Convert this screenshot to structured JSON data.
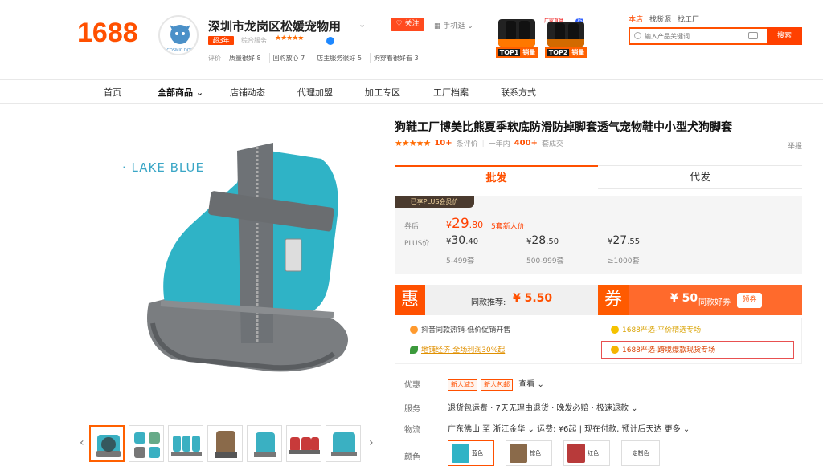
{
  "header": {
    "logo": "1688",
    "shop_name": "深圳市龙岗区松媛宠物用",
    "shop_badge": "超3年",
    "overall_label": "综合服务",
    "overall_stars": "★★★★★",
    "avatar_text": "COSMIC DOG",
    "eval_label": "评价",
    "eval_chips": [
      "质量很好 8",
      "回购放心 7",
      "店主服务很好 5",
      "狗穿着很好看 3"
    ],
    "follow_label": "关注",
    "mobile_label": "手机逛",
    "ad1_tag_num": "TOP1",
    "ad1_tag_text": "销量",
    "ad2_tag_num": "TOP2",
    "ad2_tag_text": "销量",
    "ad2_top": "厂家直供",
    "ad2_badge": "75",
    "search_tabs": [
      "本店",
      "找货源",
      "找工厂"
    ],
    "search_placeholder": "输入产品关键词",
    "search_button": "搜索"
  },
  "nav": {
    "items": [
      "首页",
      "全部商品",
      "店铺动态",
      "代理加盟",
      "加工专区",
      "工厂档案",
      "联系方式"
    ]
  },
  "product": {
    "image_caption": "· LAKE BLUE",
    "title": "狗鞋工厂博美比熊夏季软底防滑防掉脚套透气宠物鞋中小型犬狗脚套",
    "stars": "★★★★★",
    "review_count": "10+",
    "review_label": "条评价",
    "year_label": "一年内",
    "sales_count": "400+",
    "sales_label": "套成交",
    "report": "举报"
  },
  "tabs": {
    "wholesale": "批发",
    "dropship": "代发"
  },
  "price": {
    "plus_badge": "已享PLUS会员价",
    "coupon_label": "券后",
    "coupon_currency": "¥",
    "coupon_int": "29",
    "coupon_dec": ".80",
    "new_user": "5套新人价",
    "plus_label": "PLUS价",
    "tiers": [
      {
        "int": "30",
        "dec": ".40",
        "range": "5-499套"
      },
      {
        "int": "28",
        "dec": ".50",
        "range": "500-999套"
      },
      {
        "int": "27",
        "dec": ".55",
        "range": "≥1000套"
      }
    ]
  },
  "coupons": {
    "hui": "惠",
    "similar_label": "同款推荐:",
    "similar_price": "¥ 5.50",
    "quan": "券",
    "good_coupon_value": "¥ 50",
    "good_coupon_label": "同款好券",
    "claim": "领券"
  },
  "promos": [
    "抖音同款热销-低价促销开售",
    "1688严选-平价精选专场",
    "地铺经济-全场利润30%起",
    "1688严选-跨境爆款现货专场"
  ],
  "offers": {
    "label": "优惠",
    "tags": [
      "新人减3",
      "新人包邮"
    ],
    "more": "查看"
  },
  "service": {
    "label": "服务",
    "text": "退货包运费 · 7天无理由退货 · 晚发必赔 · 极速退款"
  },
  "logistics": {
    "label": "物流",
    "text": "广东佛山 至 浙江金华",
    "fee": "运费: ¥6起",
    "pay": "现在付款, 预计后天达",
    "more": "更多"
  },
  "colors": {
    "label": "颜色",
    "options": [
      "蓝色",
      "棕色",
      "红色",
      "定制色"
    ]
  }
}
